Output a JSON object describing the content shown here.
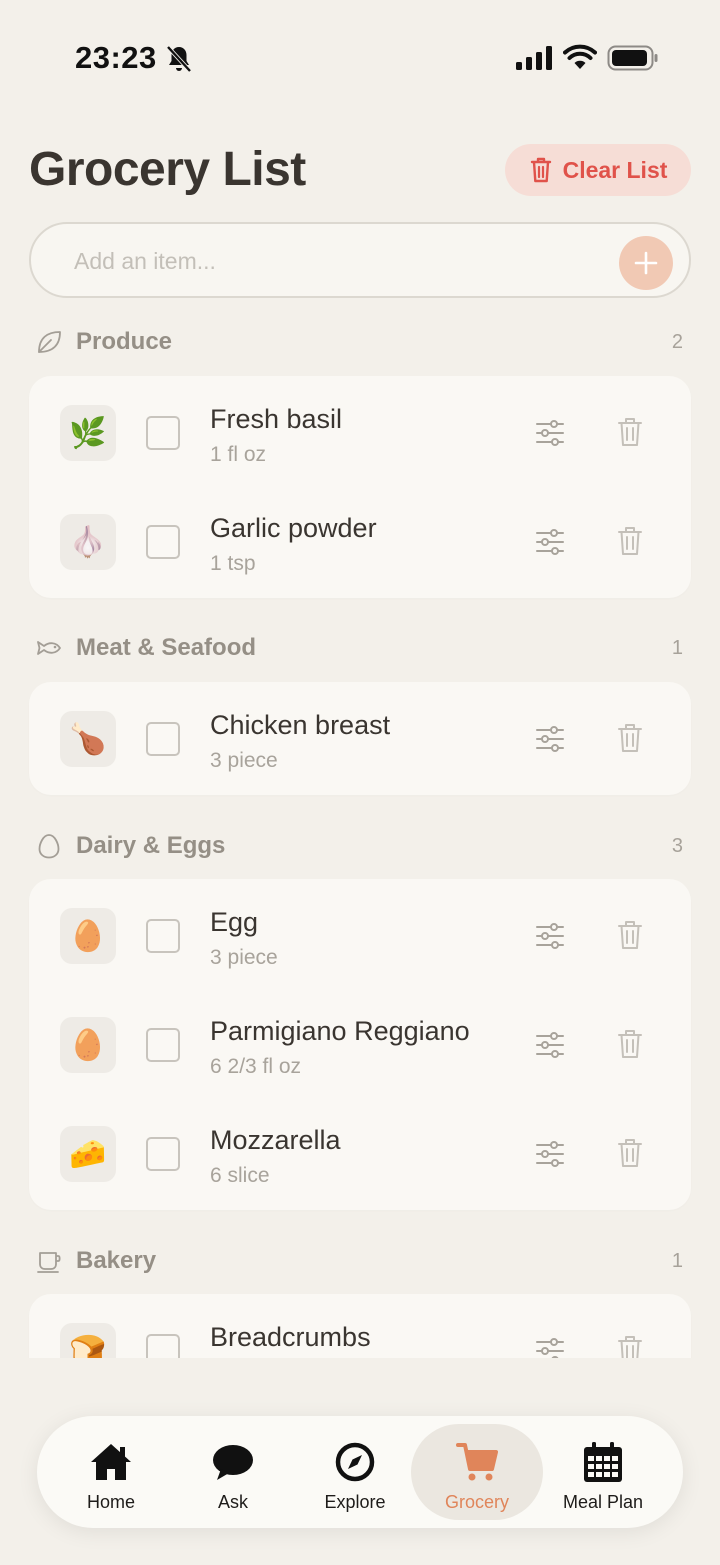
{
  "status_bar": {
    "time": "23:23"
  },
  "header": {
    "title": "Grocery List",
    "clear_label": "Clear List"
  },
  "add_item": {
    "placeholder": "Add an item..."
  },
  "sections": [
    {
      "title": "Produce",
      "count": "2",
      "icon": "leaf-icon",
      "items": [
        {
          "emoji": "🌿",
          "name": "Fresh basil",
          "qty": "1 fl oz"
        },
        {
          "emoji": "🧄",
          "name": "Garlic powder",
          "qty": "1 tsp"
        }
      ]
    },
    {
      "title": "Meat & Seafood",
      "count": "1",
      "icon": "fish-icon",
      "items": [
        {
          "emoji": "🍗",
          "name": "Chicken breast",
          "qty": "3 piece"
        }
      ]
    },
    {
      "title": "Dairy & Eggs",
      "count": "3",
      "icon": "egg-icon",
      "items": [
        {
          "emoji": "🥚",
          "name": "Egg",
          "qty": "3 piece"
        },
        {
          "emoji": "🥚",
          "name": "Parmigiano Reggiano",
          "qty": "6 2/3 fl oz"
        },
        {
          "emoji": "🧀",
          "name": "Mozzarella",
          "qty": "6 slice"
        }
      ]
    },
    {
      "title": "Bakery",
      "count": "1",
      "icon": "bakery-icon",
      "items": [
        {
          "emoji": "🍞",
          "name": "Breadcrumbs",
          "qty": ""
        }
      ]
    }
  ],
  "nav": {
    "home": "Home",
    "ask": "Ask",
    "explore": "Explore",
    "grocery": "Grocery",
    "meal_plan": "Meal Plan",
    "active": "grocery"
  },
  "colors": {
    "accent": "#e0855a",
    "danger": "#e0524a",
    "background": "#f3f0ea"
  }
}
